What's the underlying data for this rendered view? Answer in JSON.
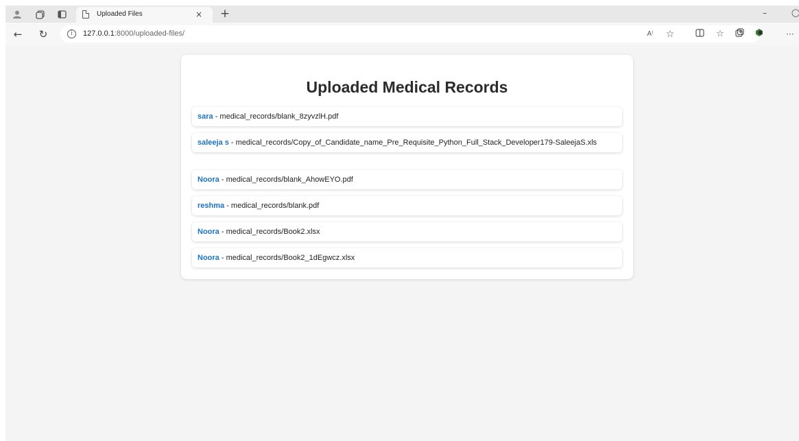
{
  "browser": {
    "tab_title": "Uploaded Files",
    "tab_close": "×",
    "new_tab": "+",
    "url_host": "127.0.0.1",
    "url_path": ":8000/uploaded-files/",
    "icons": [
      "profile-icon",
      "workspaces-icon",
      "tab-actions-icon",
      "back-icon",
      "refresh-icon",
      "site-info-icon",
      "read-aloud-icon",
      "favorite-icon",
      "split-screen-icon",
      "favorites-icon",
      "collections-icon",
      "extension-icon",
      "more-icon"
    ],
    "read_aloud_label": "A⁾",
    "more_label": "···",
    "minimize_label": "–"
  },
  "page": {
    "title": "Uploaded Medical Records",
    "separator": " - ",
    "records": [
      {
        "user": "sara",
        "file": "medical_records/blank_8zyvzlH.pdf"
      },
      {
        "user": "saleeja s",
        "file": "medical_records/Copy_of_Candidate_name_Pre_Requisite_Python_Full_Stack_Developer179-SaleejaS.xls"
      },
      {
        "user": "Noora",
        "file": "medical_records/blank_AhowEYO.pdf"
      },
      {
        "user": "reshma",
        "file": "medical_records/blank.pdf"
      },
      {
        "user": "Noora",
        "file": "medical_records/Book2.xlsx"
      },
      {
        "user": "Noora",
        "file": "medical_records/Book2_1dEgwcz.xlsx"
      }
    ]
  },
  "colors": {
    "username": "#1a73c8",
    "background": "#f4f4f4"
  }
}
